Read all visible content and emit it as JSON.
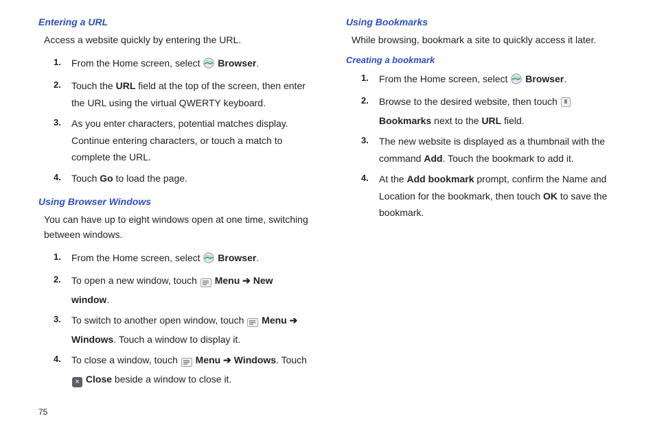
{
  "page_number": "75",
  "col1": {
    "s1": {
      "heading": "Entering a URL",
      "intro": "Access a website quickly by entering the URL.",
      "steps": [
        {
          "pre": "From the Home screen, select ",
          "icon": "globe",
          "bold1": "Browser",
          "post": "."
        },
        {
          "pre": "Touch the ",
          "bold1": "URL",
          "mid": " field at the top of the screen, then enter the URL using the virtual QWERTY keyboard."
        },
        {
          "pre": "As you enter characters, potential matches display. Continue entering characters, or touch a match to complete the URL."
        },
        {
          "pre": "Touch ",
          "bold1": "Go",
          "post": " to load the page."
        }
      ]
    },
    "s2": {
      "heading": "Using Browser Windows",
      "intro": "You can have up to eight windows open at one time, switching between windows.",
      "steps": [
        {
          "pre": "From the Home screen, select ",
          "icon": "globe",
          "bold1": "Browser",
          "post": "."
        },
        {
          "pre": "To open a new window, touch ",
          "icon": "menu",
          "bold1": "Menu",
          "arrow": " ➔ ",
          "bold2": "New window",
          "post": "."
        },
        {
          "pre": "To switch to another open window, touch ",
          "icon": "menu",
          "bold1": "Menu",
          "arrow": " ➔ ",
          "bold2": "Windows",
          "post": ". Touch a window to display it."
        },
        {
          "pre": "To close a window, touch ",
          "icon": "menu",
          "bold1": "Menu",
          "arrow": " ➔ ",
          "bold2": "Windows",
          "post": ". Touch ",
          "icon2": "x",
          "bold3": "Close",
          "post2": " beside a window to close it."
        }
      ]
    }
  },
  "col2": {
    "s1": {
      "heading": "Using Bookmarks",
      "intro": "While browsing, bookmark a site to quickly access it later.",
      "sub": "Creating a bookmark",
      "steps": [
        {
          "pre": "From the Home screen, select ",
          "icon": "globe",
          "bold1": "Browser",
          "post": "."
        },
        {
          "pre": "Browse to the desired website, then touch ",
          "icon": "bm",
          "bold1": "Bookmarks",
          "post": " next to the ",
          "bold2": "URL",
          "post2": " field."
        },
        {
          "pre": "The new website is displayed as a thumbnail with the command ",
          "bold1": "Add",
          "post": ". Touch the bookmark to add it."
        },
        {
          "pre": "At the ",
          "bold1": "Add bookmark",
          "mid": " prompt, confirm the Name and Location for the bookmark, then touch ",
          "bold2": "OK",
          "post": " to save the bookmark."
        }
      ]
    }
  }
}
